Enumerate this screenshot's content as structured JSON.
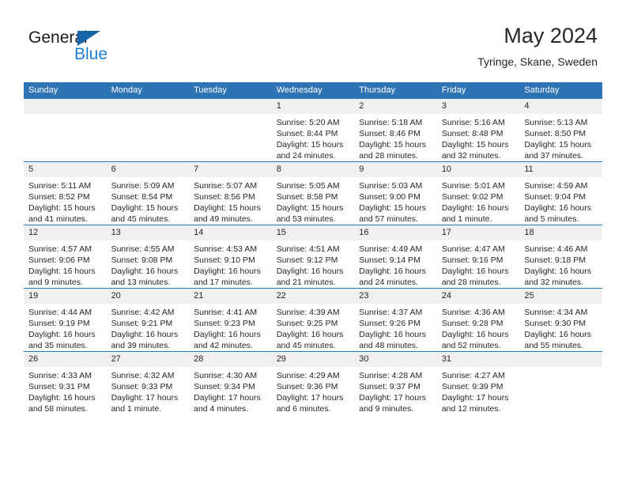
{
  "brand": {
    "name_part1": "General",
    "name_part2": "Blue",
    "logo_icon": "blue-triangle-flag-icon"
  },
  "header": {
    "title": "May 2024",
    "subtitle": "Tyringe, Skane, Sweden"
  },
  "colors": {
    "header_blue": "#2e74b5",
    "brand_blue": "#1b7fd4",
    "daynum_band": "#f0f0f0",
    "text": "#262626"
  },
  "weekday_headers": [
    "Sunday",
    "Monday",
    "Tuesday",
    "Wednesday",
    "Thursday",
    "Friday",
    "Saturday"
  ],
  "weeks": [
    [
      {
        "day": "",
        "empty": true
      },
      {
        "day": "",
        "empty": true
      },
      {
        "day": "",
        "empty": true
      },
      {
        "day": "1",
        "sunrise": "Sunrise: 5:20 AM",
        "sunset": "Sunset: 8:44 PM",
        "daylight_1": "Daylight: 15 hours",
        "daylight_2": "and 24 minutes."
      },
      {
        "day": "2",
        "sunrise": "Sunrise: 5:18 AM",
        "sunset": "Sunset: 8:46 PM",
        "daylight_1": "Daylight: 15 hours",
        "daylight_2": "and 28 minutes."
      },
      {
        "day": "3",
        "sunrise": "Sunrise: 5:16 AM",
        "sunset": "Sunset: 8:48 PM",
        "daylight_1": "Daylight: 15 hours",
        "daylight_2": "and 32 minutes."
      },
      {
        "day": "4",
        "sunrise": "Sunrise: 5:13 AM",
        "sunset": "Sunset: 8:50 PM",
        "daylight_1": "Daylight: 15 hours",
        "daylight_2": "and 37 minutes."
      }
    ],
    [
      {
        "day": "5",
        "sunrise": "Sunrise: 5:11 AM",
        "sunset": "Sunset: 8:52 PM",
        "daylight_1": "Daylight: 15 hours",
        "daylight_2": "and 41 minutes."
      },
      {
        "day": "6",
        "sunrise": "Sunrise: 5:09 AM",
        "sunset": "Sunset: 8:54 PM",
        "daylight_1": "Daylight: 15 hours",
        "daylight_2": "and 45 minutes."
      },
      {
        "day": "7",
        "sunrise": "Sunrise: 5:07 AM",
        "sunset": "Sunset: 8:56 PM",
        "daylight_1": "Daylight: 15 hours",
        "daylight_2": "and 49 minutes."
      },
      {
        "day": "8",
        "sunrise": "Sunrise: 5:05 AM",
        "sunset": "Sunset: 8:58 PM",
        "daylight_1": "Daylight: 15 hours",
        "daylight_2": "and 53 minutes."
      },
      {
        "day": "9",
        "sunrise": "Sunrise: 5:03 AM",
        "sunset": "Sunset: 9:00 PM",
        "daylight_1": "Daylight: 15 hours",
        "daylight_2": "and 57 minutes."
      },
      {
        "day": "10",
        "sunrise": "Sunrise: 5:01 AM",
        "sunset": "Sunset: 9:02 PM",
        "daylight_1": "Daylight: 16 hours",
        "daylight_2": "and 1 minute."
      },
      {
        "day": "11",
        "sunrise": "Sunrise: 4:59 AM",
        "sunset": "Sunset: 9:04 PM",
        "daylight_1": "Daylight: 16 hours",
        "daylight_2": "and 5 minutes."
      }
    ],
    [
      {
        "day": "12",
        "sunrise": "Sunrise: 4:57 AM",
        "sunset": "Sunset: 9:06 PM",
        "daylight_1": "Daylight: 16 hours",
        "daylight_2": "and 9 minutes."
      },
      {
        "day": "13",
        "sunrise": "Sunrise: 4:55 AM",
        "sunset": "Sunset: 9:08 PM",
        "daylight_1": "Daylight: 16 hours",
        "daylight_2": "and 13 minutes."
      },
      {
        "day": "14",
        "sunrise": "Sunrise: 4:53 AM",
        "sunset": "Sunset: 9:10 PM",
        "daylight_1": "Daylight: 16 hours",
        "daylight_2": "and 17 minutes."
      },
      {
        "day": "15",
        "sunrise": "Sunrise: 4:51 AM",
        "sunset": "Sunset: 9:12 PM",
        "daylight_1": "Daylight: 16 hours",
        "daylight_2": "and 21 minutes."
      },
      {
        "day": "16",
        "sunrise": "Sunrise: 4:49 AM",
        "sunset": "Sunset: 9:14 PM",
        "daylight_1": "Daylight: 16 hours",
        "daylight_2": "and 24 minutes."
      },
      {
        "day": "17",
        "sunrise": "Sunrise: 4:47 AM",
        "sunset": "Sunset: 9:16 PM",
        "daylight_1": "Daylight: 16 hours",
        "daylight_2": "and 28 minutes."
      },
      {
        "day": "18",
        "sunrise": "Sunrise: 4:46 AM",
        "sunset": "Sunset: 9:18 PM",
        "daylight_1": "Daylight: 16 hours",
        "daylight_2": "and 32 minutes."
      }
    ],
    [
      {
        "day": "19",
        "sunrise": "Sunrise: 4:44 AM",
        "sunset": "Sunset: 9:19 PM",
        "daylight_1": "Daylight: 16 hours",
        "daylight_2": "and 35 minutes."
      },
      {
        "day": "20",
        "sunrise": "Sunrise: 4:42 AM",
        "sunset": "Sunset: 9:21 PM",
        "daylight_1": "Daylight: 16 hours",
        "daylight_2": "and 39 minutes."
      },
      {
        "day": "21",
        "sunrise": "Sunrise: 4:41 AM",
        "sunset": "Sunset: 9:23 PM",
        "daylight_1": "Daylight: 16 hours",
        "daylight_2": "and 42 minutes."
      },
      {
        "day": "22",
        "sunrise": "Sunrise: 4:39 AM",
        "sunset": "Sunset: 9:25 PM",
        "daylight_1": "Daylight: 16 hours",
        "daylight_2": "and 45 minutes."
      },
      {
        "day": "23",
        "sunrise": "Sunrise: 4:37 AM",
        "sunset": "Sunset: 9:26 PM",
        "daylight_1": "Daylight: 16 hours",
        "daylight_2": "and 48 minutes."
      },
      {
        "day": "24",
        "sunrise": "Sunrise: 4:36 AM",
        "sunset": "Sunset: 9:28 PM",
        "daylight_1": "Daylight: 16 hours",
        "daylight_2": "and 52 minutes."
      },
      {
        "day": "25",
        "sunrise": "Sunrise: 4:34 AM",
        "sunset": "Sunset: 9:30 PM",
        "daylight_1": "Daylight: 16 hours",
        "daylight_2": "and 55 minutes."
      }
    ],
    [
      {
        "day": "26",
        "sunrise": "Sunrise: 4:33 AM",
        "sunset": "Sunset: 9:31 PM",
        "daylight_1": "Daylight: 16 hours",
        "daylight_2": "and 58 minutes."
      },
      {
        "day": "27",
        "sunrise": "Sunrise: 4:32 AM",
        "sunset": "Sunset: 9:33 PM",
        "daylight_1": "Daylight: 17 hours",
        "daylight_2": "and 1 minute."
      },
      {
        "day": "28",
        "sunrise": "Sunrise: 4:30 AM",
        "sunset": "Sunset: 9:34 PM",
        "daylight_1": "Daylight: 17 hours",
        "daylight_2": "and 4 minutes."
      },
      {
        "day": "29",
        "sunrise": "Sunrise: 4:29 AM",
        "sunset": "Sunset: 9:36 PM",
        "daylight_1": "Daylight: 17 hours",
        "daylight_2": "and 6 minutes."
      },
      {
        "day": "30",
        "sunrise": "Sunrise: 4:28 AM",
        "sunset": "Sunset: 9:37 PM",
        "daylight_1": "Daylight: 17 hours",
        "daylight_2": "and 9 minutes."
      },
      {
        "day": "31",
        "sunrise": "Sunrise: 4:27 AM",
        "sunset": "Sunset: 9:39 PM",
        "daylight_1": "Daylight: 17 hours",
        "daylight_2": "and 12 minutes."
      },
      {
        "day": "",
        "empty": true
      }
    ]
  ]
}
